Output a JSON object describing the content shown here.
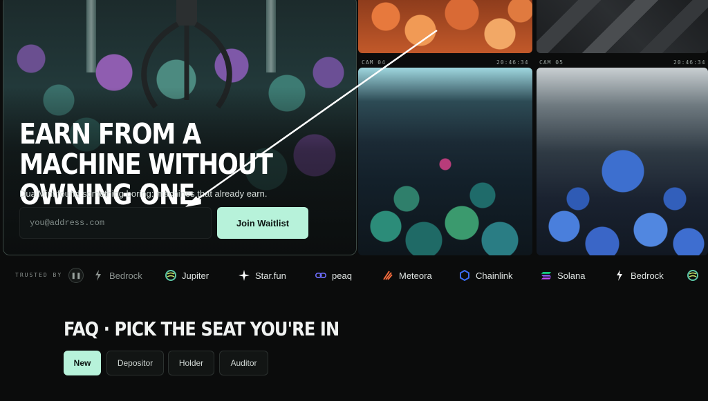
{
  "hero": {
    "title": "Earn from a machine without owning one.",
    "subtitle": "DualMint found something boring: machines that already earn.",
    "email_placeholder": "you@address.com",
    "join_label": "Join Waitlist"
  },
  "cams": [
    {
      "label": "CAM 04",
      "time": "20:46:34"
    },
    {
      "label": "CAM 05",
      "time": "20:46:34"
    }
  ],
  "trusted": {
    "label": "TRUSTED BY",
    "pause_icon": "pause-icon",
    "partners": [
      {
        "name": "Bedrock",
        "icon": "bedrock-icon"
      },
      {
        "name": "Jupiter",
        "icon": "jupiter-icon"
      },
      {
        "name": "Star.fun",
        "icon": "star-icon"
      },
      {
        "name": "peaq",
        "icon": "peaq-icon"
      },
      {
        "name": "Meteora",
        "icon": "meteora-icon"
      },
      {
        "name": "Chainlink",
        "icon": "chainlink-icon"
      },
      {
        "name": "Solana",
        "icon": "solana-icon"
      },
      {
        "name": "Bedrock",
        "icon": "bedrock-icon"
      }
    ]
  },
  "faq": {
    "title": "FAQ · Pick the seat you're in",
    "tabs": [
      "New",
      "Depositor",
      "Holder",
      "Auditor"
    ],
    "active_tab": "New"
  },
  "colors": {
    "accent": "#b7f2da",
    "background": "#0b0c0c"
  }
}
